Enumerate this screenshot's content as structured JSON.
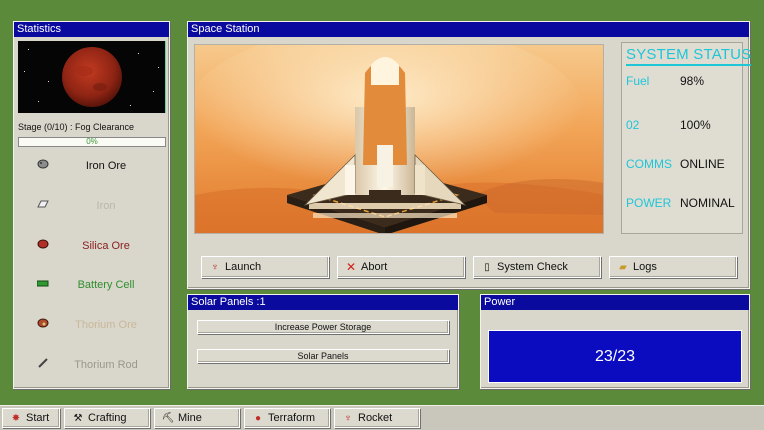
{
  "colors": {
    "desktop": "#5b8a3a",
    "titlebar": "#0a0a9e",
    "status_cyan": "#1ec6d8",
    "power_display": "#0b0bbf",
    "progress_text": "#3a9a3a"
  },
  "stats": {
    "title": "Statistics",
    "stage_label": "Stage (0/10) : Fog Clearance",
    "progress": {
      "value": 0,
      "text": "0%"
    },
    "resources": [
      {
        "label": "Iron Ore",
        "icon": "iron-ore-icon",
        "color": "#111111"
      },
      {
        "label": "Iron",
        "icon": "iron-ingot-icon",
        "color": "#b9b6ad"
      },
      {
        "label": "Silica Ore",
        "icon": "silica-ore-icon",
        "color": "#8a2020"
      },
      {
        "label": "Battery Cell",
        "icon": "battery-icon",
        "color": "#2f8f2f"
      },
      {
        "label": "Thorium Ore",
        "icon": "thorium-ore-icon",
        "color": "#c9b89a"
      },
      {
        "label": "Thorium Rod",
        "icon": "thorium-rod-icon",
        "color": "#9a978d"
      }
    ]
  },
  "station": {
    "title": "Space Station",
    "status": {
      "title": "SYSTEM STATUS",
      "rows": [
        {
          "key": "Fuel",
          "value": "98%"
        },
        {
          "key": "02",
          "value": "100%"
        },
        {
          "key": "COMMS",
          "value": "ONLINE"
        },
        {
          "key": "POWER",
          "value": "NOMINAL"
        }
      ]
    },
    "buttons": {
      "launch": "Launch",
      "abort": "Abort",
      "check": "System Check",
      "logs": "Logs"
    }
  },
  "solar": {
    "title": "Solar Panels :1",
    "increase_label": "Increase Power Storage",
    "panels_label": "Solar Panels"
  },
  "power": {
    "title": "Power",
    "reading": "23/23"
  },
  "taskbar": {
    "start": "Start",
    "crafting": "Crafting",
    "mine": "Mine",
    "terraform": "Terraform",
    "rocket": "Rocket"
  }
}
